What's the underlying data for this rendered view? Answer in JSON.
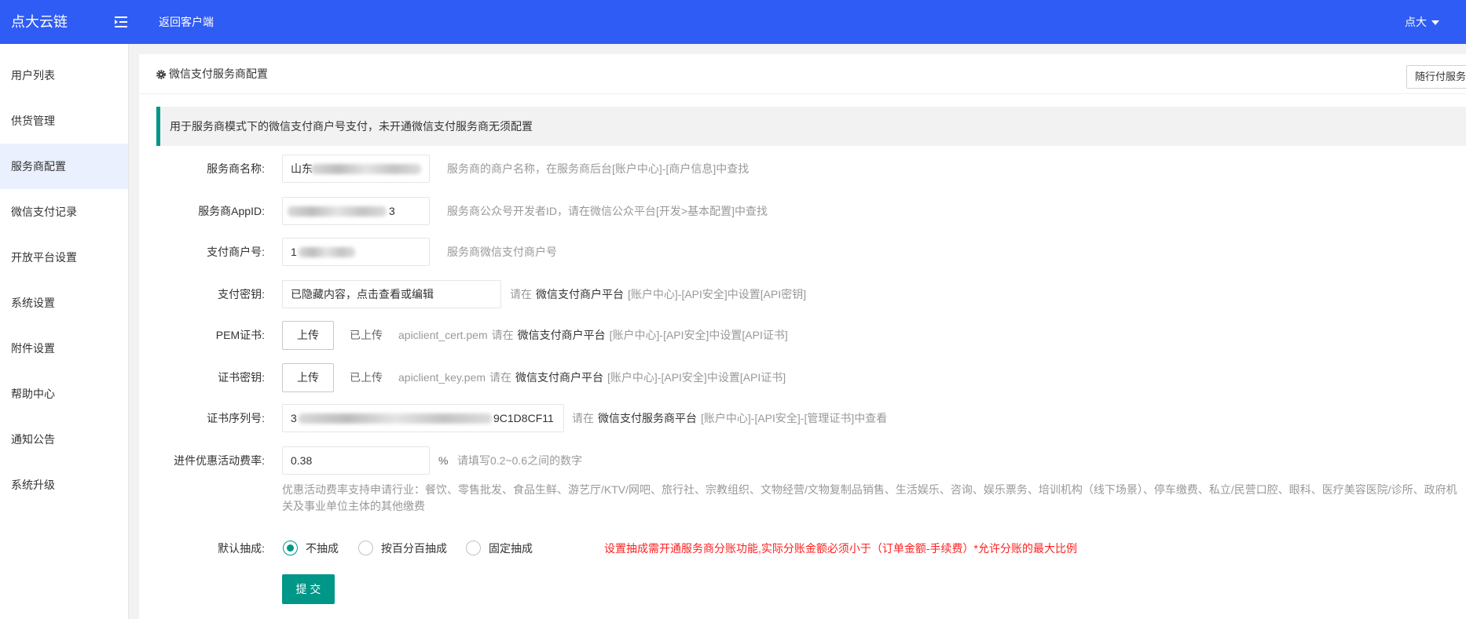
{
  "colors": {
    "header_bg": "#2f5cf4",
    "accent": "#009688",
    "warning": "#ff2020",
    "sidebar_active_bg": "#eaf0fd"
  },
  "header": {
    "logo": "点大云链",
    "back_link": "返回客户端",
    "user": "点大",
    "icons": [
      "sidebar-fold-icon",
      "caret-down-icon"
    ]
  },
  "sidebar": {
    "items": [
      "用户列表",
      "供货管理",
      "服务商配置",
      "微信支付记录",
      "开放平台设置",
      "系统设置",
      "附件设置",
      "帮助中心",
      "通知公告",
      "系统升级"
    ],
    "active_index": 2
  },
  "card": {
    "icon": "gear-icon",
    "title": "微信支付服务商配置",
    "corner_button": "随行付服务商",
    "notice": "用于服务商模式下的微信支付商户号支付，未开通微信支付服务商无须配置"
  },
  "form": {
    "name": {
      "label": "服务商名称:",
      "value_visible": "山东",
      "hint": "服务商的商户名称，在服务商后台[账户中心]-[商户信息]中查找"
    },
    "appid": {
      "label": "服务商AppID:",
      "value_visible_end": "3",
      "hint": "服务商公众号开发者ID，请在微信公众平台[开发>基本配置]中查找"
    },
    "mchid": {
      "label": "支付商户号:",
      "value_visible": "1",
      "hint": "服务商微信支付商户号"
    },
    "key": {
      "label": "支付密钥:",
      "value": "已隐藏内容，点击查看或编辑",
      "hint_pre": "请在",
      "hint_link": "微信支付商户平台",
      "hint_post": "[账户中心]-[API安全]中设置[API密钥]"
    },
    "pem": {
      "label": "PEM证书:",
      "button": "上传",
      "status": "已上传",
      "file": "apiclient_cert.pem",
      "hint_pre": "请在",
      "hint_link": "微信支付商户平台",
      "hint_post": "[账户中心]-[API安全]中设置[API证书]"
    },
    "cert_key": {
      "label": "证书密钥:",
      "button": "上传",
      "status": "已上传",
      "file": "apiclient_key.pem",
      "hint_pre": "请在",
      "hint_link": "微信支付商户平台",
      "hint_post": "[账户中心]-[API安全]中设置[API证书]"
    },
    "serial": {
      "label": "证书序列号:",
      "value_visible_start": "3",
      "value_visible_end": "9C1D8CF11",
      "hint_pre": "请在",
      "hint_link": "微信支付服务商平台",
      "hint_post": "[账户中心]-[API安全]-[管理证书]中查看"
    },
    "rate": {
      "label": "进件优惠活动费率:",
      "value": "0.38",
      "unit": "%",
      "hint": "请填写0.2~0.6之间的数字",
      "note_lines": [
        "优惠活动费率支持申请行业：餐饮、零售批发、食品生鲜、游艺厅/KTV/网吧、旅行社、宗教组织、文物经营/文物复制品销售、生活娱乐、咨询、娱乐票务、培训机构（线下场景）、停车缴费、私立/民营口腔、眼科、医疗美容医院/诊所、政府机",
        "关及事业单位主体的其他缴费"
      ]
    },
    "commission": {
      "label": "默认抽成:",
      "options": [
        "不抽成",
        "按百分百抽成",
        "固定抽成"
      ],
      "selected_index": 0,
      "warning": "设置抽成需开通服务商分账功能,实际分账金额必须小于（订单金额-手续费）*允许分账的最大比例"
    },
    "submit": "提 交"
  }
}
